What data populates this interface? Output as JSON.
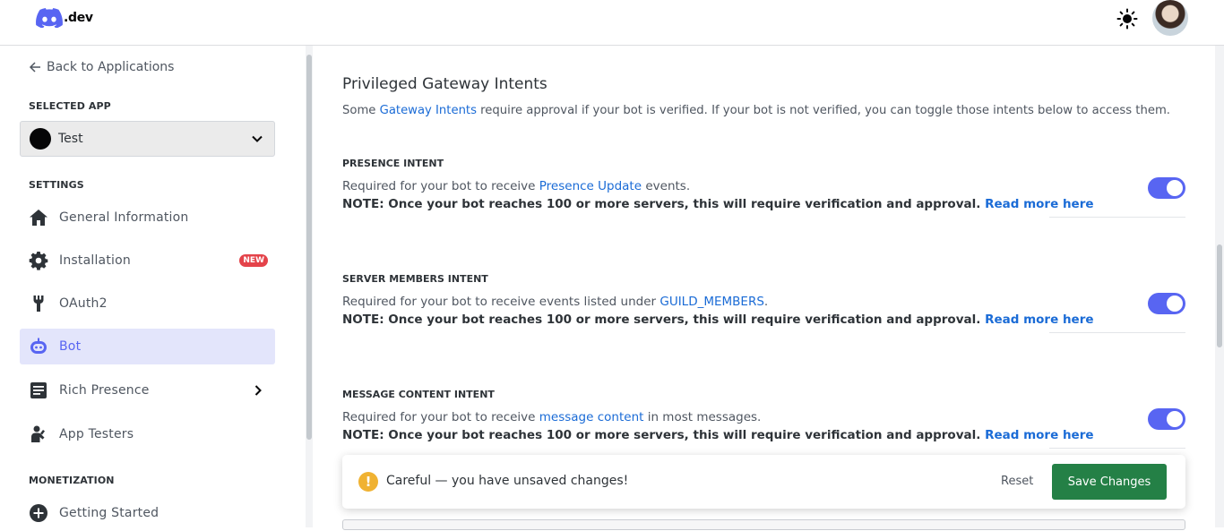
{
  "brand": {
    "logo_text": ".dev",
    "logo_color": "#5865f2"
  },
  "header": {
    "theme_icon": "sun-icon",
    "avatar": "user-avatar"
  },
  "sidebar": {
    "back_label": "Back to Applications",
    "selected_app_heading": "SELECTED APP",
    "selected_app_name": "Test",
    "settings_heading": "SETTINGS",
    "items": [
      {
        "label": "General Information",
        "icon": "home-icon"
      },
      {
        "label": "Installation",
        "icon": "gear-icon",
        "badge": "NEW"
      },
      {
        "label": "OAuth2",
        "icon": "wrench-icon"
      },
      {
        "label": "Bot",
        "icon": "bot-icon",
        "active": true
      },
      {
        "label": "Rich Presence",
        "icon": "document-icon"
      },
      {
        "label": "App Testers",
        "icon": "person-icon"
      }
    ],
    "monetization_heading": "MONETIZATION",
    "monetization_items": [
      {
        "label": "Getting Started",
        "icon": "plus-circle-icon"
      }
    ]
  },
  "main": {
    "title": "Privileged Gateway Intents",
    "subtitle_before": "Some ",
    "subtitle_link": "Gateway Intents",
    "subtitle_after": " require approval if your bot is verified. If your bot is not verified, you can toggle those intents below to access them.",
    "intents": [
      {
        "label": "PRESENCE INTENT",
        "desc_before": "Required for your bot to receive ",
        "desc_link": "Presence Update",
        "desc_after": " events.",
        "note": "NOTE: Once your bot reaches 100 or more servers, this will require verification and approval. ",
        "note_link": "Read more here",
        "enabled": true
      },
      {
        "label": "SERVER MEMBERS INTENT",
        "desc_before": "Required for your bot to receive events listed under ",
        "desc_link": "GUILD_MEMBERS",
        "desc_after": ".",
        "note": "NOTE: Once your bot reaches 100 or more servers, this will require verification and approval. ",
        "note_link": "Read more here",
        "enabled": true
      },
      {
        "label": "MESSAGE CONTENT INTENT",
        "desc_before": "Required for your bot to receive ",
        "desc_link": "message content",
        "desc_after": " in most messages.",
        "note": "NOTE: Once your bot reaches 100 or more servers, this will require verification and approval. ",
        "note_link": "Read more here",
        "enabled": true
      }
    ]
  },
  "unsaved_bar": {
    "message": "Careful — you have unsaved changes!",
    "reset_label": "Reset",
    "save_label": "Save Changes",
    "warning_glyph": "!"
  },
  "colors": {
    "accent": "#5865f2",
    "save": "#248046",
    "link": "#1a6bd6",
    "warning": "#f0b232",
    "badge": "#e4434a"
  }
}
